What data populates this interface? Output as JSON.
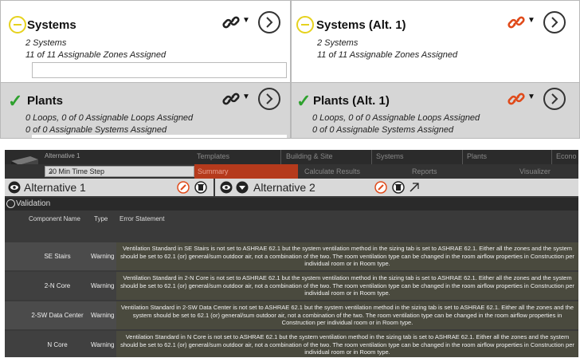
{
  "cards": {
    "systems": {
      "title": "Systems",
      "count": "2 Systems",
      "assigned": "11 of 11 Assignable Zones Assigned"
    },
    "systems_alt": {
      "title": "Systems (Alt. 1)",
      "count": "2 Systems",
      "assigned": "11 of 11 Assignable Zones Assigned"
    },
    "plants": {
      "title": "Plants",
      "loops": "0 Loops, 0 of 0 Assignable Loops Assigned",
      "systems": "0 of 0 Assignable Systems Assigned"
    },
    "plants_alt": {
      "title": "Plants (Alt. 1)",
      "loops": "0 Loops, 0 of 0 Assignable Loops Assigned",
      "systems": "0 of 0 Assignable Systems Assigned"
    }
  },
  "colors": {
    "warning_circle": "#e6d21e",
    "check_green": "#2ea12e",
    "link_orange": "#e04a1a",
    "nav_active": "#b53a1c"
  },
  "app": {
    "alt_label": "Alternative 1",
    "time_step": "20 Min Time Step",
    "nav": [
      "Templates",
      "Building & Site",
      "Systems",
      "Plants",
      "Econo"
    ],
    "subnav": {
      "active": "Summary",
      "items": [
        "Calculate Results",
        "Reports",
        "Visualizer"
      ]
    },
    "alternatives": [
      "Alternative 1",
      "Alternative 2"
    ],
    "validation_label": "Validation",
    "columns": {
      "name": "Component Name",
      "type": "Type",
      "error": "Error Statement"
    },
    "rows": [
      {
        "name": "SE Stairs",
        "type": "Warning",
        "error": "Ventilation Standard in SE Stairs is not set to ASHRAE 62.1 but the system ventilation method in the sizing tab is set to ASHRAE 62.1. Either all the zones and the system should be set to 62.1 (or) general/sum outdoor air, not a combination of the two. The room ventilation type can be changed in the room airflow properties in Construction per individual room or in Room type."
      },
      {
        "name": "2-N Core",
        "type": "Warning",
        "error": "Ventilation Standard in 2-N Core is not set to ASHRAE 62.1 but the system ventilation method in the sizing tab is set to ASHRAE 62.1. Either all the zones and the system should be set to 62.1 (or) general/sum outdoor air, not a combination of the two. The room ventilation type can be changed in the room airflow properties in Construction per individual room or in Room type."
      },
      {
        "name": "2-SW Data Center",
        "type": "Warning",
        "error": "Ventilation Standard in 2-SW Data Center is not set to ASHRAE 62.1 but the system ventilation method in the sizing tab is set to ASHRAE 62.1. Either all the zones and the system should be set to 62.1 (or) general/sum outdoor air, not a combination of the two. The room ventilation type can be changed in the room airflow properties in Construction per individual room or in Room type."
      },
      {
        "name": "N Core",
        "type": "Warning",
        "error": "Ventilation Standard in N Core is not set to ASHRAE 62.1 but the system ventilation method in the sizing tab is set to ASHRAE 62.1. Either all the zones and the system should be set to 62.1 (or) general/sum outdoor air, not a combination of the two. The room ventilation type can be changed in the room airflow properties in Construction per individual room or in Room type."
      }
    ]
  }
}
